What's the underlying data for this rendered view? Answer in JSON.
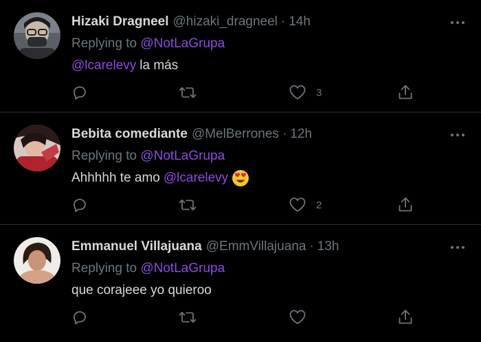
{
  "tweets": [
    {
      "name": "Hizaki Dragneel",
      "handle": "@hizaki_dragneel",
      "dot": "·",
      "time": "14h",
      "replying_label": "Replying to",
      "replying_to": "@NotLaGrupa",
      "text_mention": "@lcarelevy",
      "text": "la más",
      "like_count": "3",
      "avatar_icon": "masked-person-avatar"
    },
    {
      "name": "Bebita comediante",
      "handle": "@MelBerrones",
      "dot": "·",
      "time": "12h",
      "replying_label": "Replying to",
      "replying_to": "@NotLaGrupa",
      "text": "Ahhhhh te amo",
      "text_mention": "@lcarelevy",
      "emoji": "heart-eyes-emoji",
      "like_count": "2",
      "avatar_icon": "woman-red-avatar"
    },
    {
      "name": "Emmanuel Villajuana",
      "handle": "@EmmVillajuana",
      "dot": "·",
      "time": "13h",
      "replying_label": "Replying to",
      "replying_to": "@NotLaGrupa",
      "text": "que corajeee yo quieroo",
      "like_count": "",
      "avatar_icon": "person-skin-avatar"
    }
  ],
  "icons": {
    "reply": "reply-icon",
    "retweet": "retweet-icon",
    "like": "heart-icon",
    "share": "share-icon",
    "more": "more-icon"
  },
  "colors": {
    "background": "#000000",
    "text": "#d9d9d9",
    "secondary": "#6e767d",
    "mention": "#8a4ce3",
    "divider": "#2f3336"
  }
}
